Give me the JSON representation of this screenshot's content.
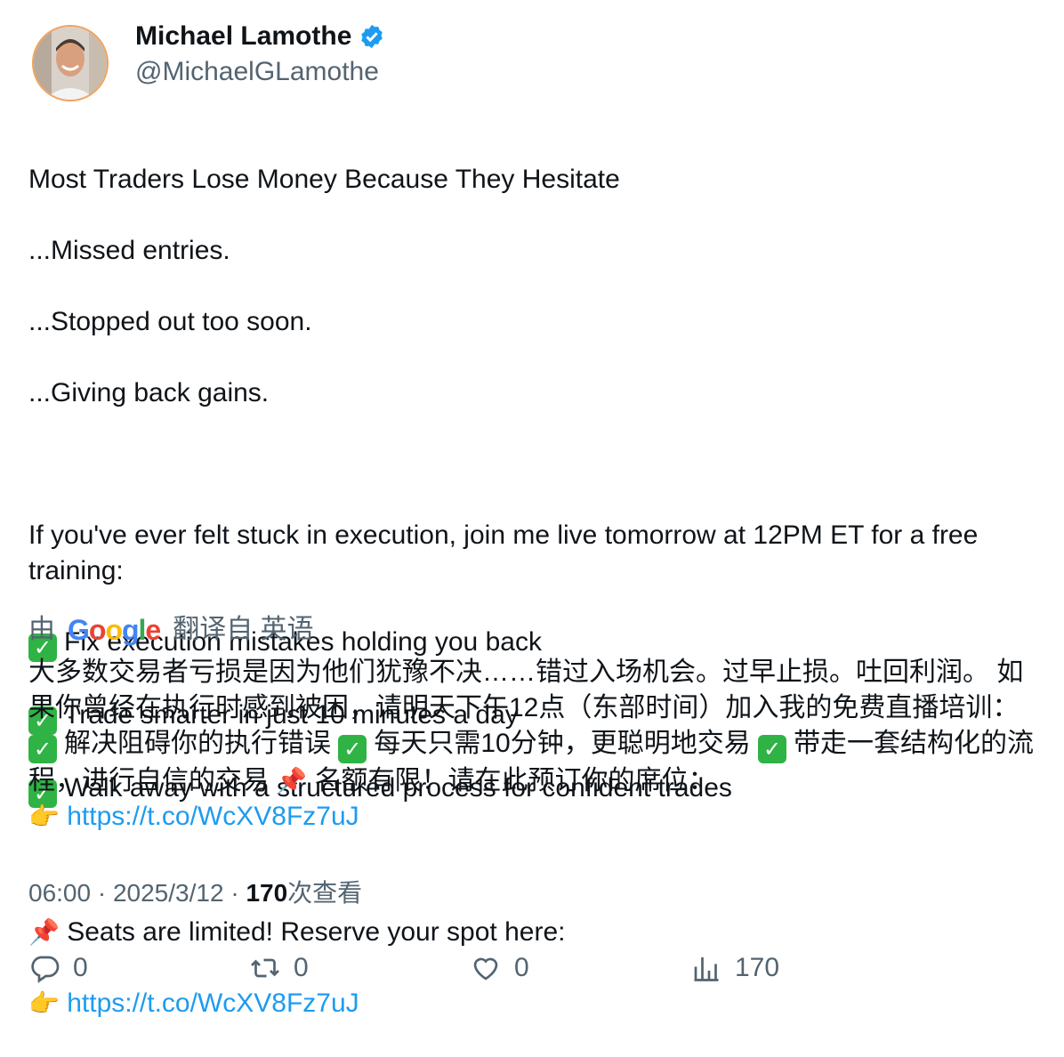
{
  "author": {
    "name": "Michael Lamothe",
    "handle": "@MichaelGLamothe",
    "verified": true
  },
  "tweet": {
    "lines": [
      "Most Traders Lose Money Because They Hesitate",
      "...Missed entries.",
      "...Stopped out too soon.",
      "...Giving back gains.",
      "",
      "If you've ever felt stuck in execution, join me live tomorrow at 12PM ET for a free training:"
    ],
    "checks": [
      "Fix execution mistakes holding you back",
      "Trade smarter in just 10 minutes a day",
      "Walk away with a structured process for confident trades"
    ],
    "pin_text": "Seats are limited! Reserve your spot here:",
    "link": "https://t.co/WcXV8Fz7uJ"
  },
  "translation": {
    "prefix": "由",
    "provider": "Google",
    "suffix": "翻译自 英语",
    "text": "大多数交易者亏损是因为他们犹豫不决……错过入场机会。过早止损。吐回利润。 如果你曾经在执行时感到被困，请明天下午12点（东部时间）加入我的免费直播培训：",
    "check_1": "解决阻碍你的执行错误",
    "check_2": "每天只需10分钟，更聪明地交易",
    "check_3": "带走一套结构化的流程，进行自信的交易",
    "pin_text": "名额有限！请在此预订你的席位：",
    "link": "https://t.co/WcXV8Fz7uJ"
  },
  "meta": {
    "time": "06:00",
    "date": "2025/3/12",
    "views": "170",
    "views_label": "次查看"
  },
  "actions": {
    "replies": "0",
    "reposts": "0",
    "likes": "0",
    "views": "170"
  }
}
